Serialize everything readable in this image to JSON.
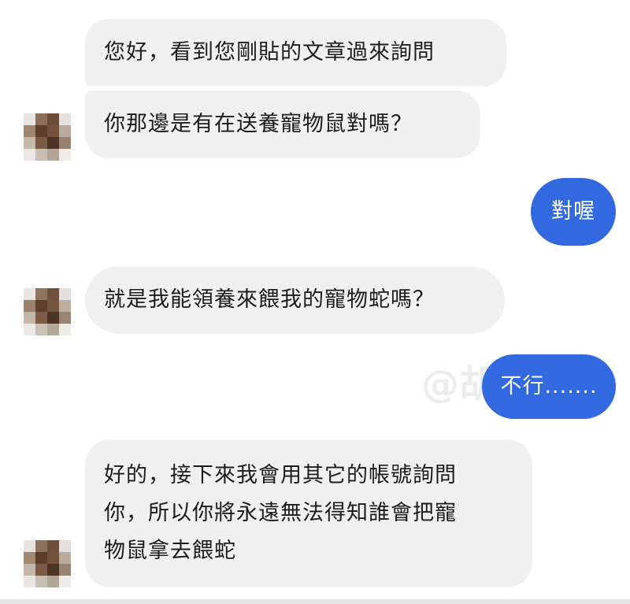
{
  "messages": {
    "m1": "您好，看到您剛貼的文章過來詢問",
    "m2": "你那邊是有在送養寵物鼠對嗎？",
    "m3": "對喔",
    "m4": "就是我能領養來餵我的寵物蛇嗎？",
    "m5": "不行.......",
    "m6": {
      "line1": "好的，接下來我會用其它的帳號詢問",
      "line2": "你，所以你將永遠無法得知誰會把寵",
      "line3": "物鼠拿去餵蛇"
    }
  },
  "watermark": "@胡蘿蔔",
  "colors": {
    "incoming_bubble": "#f0f0f0",
    "outgoing_bubble": "#3269e0",
    "incoming_text": "#1c1c1c",
    "outgoing_text": "#ffffff"
  },
  "avatar": {
    "icon": "pixelated-avatar-icon"
  }
}
